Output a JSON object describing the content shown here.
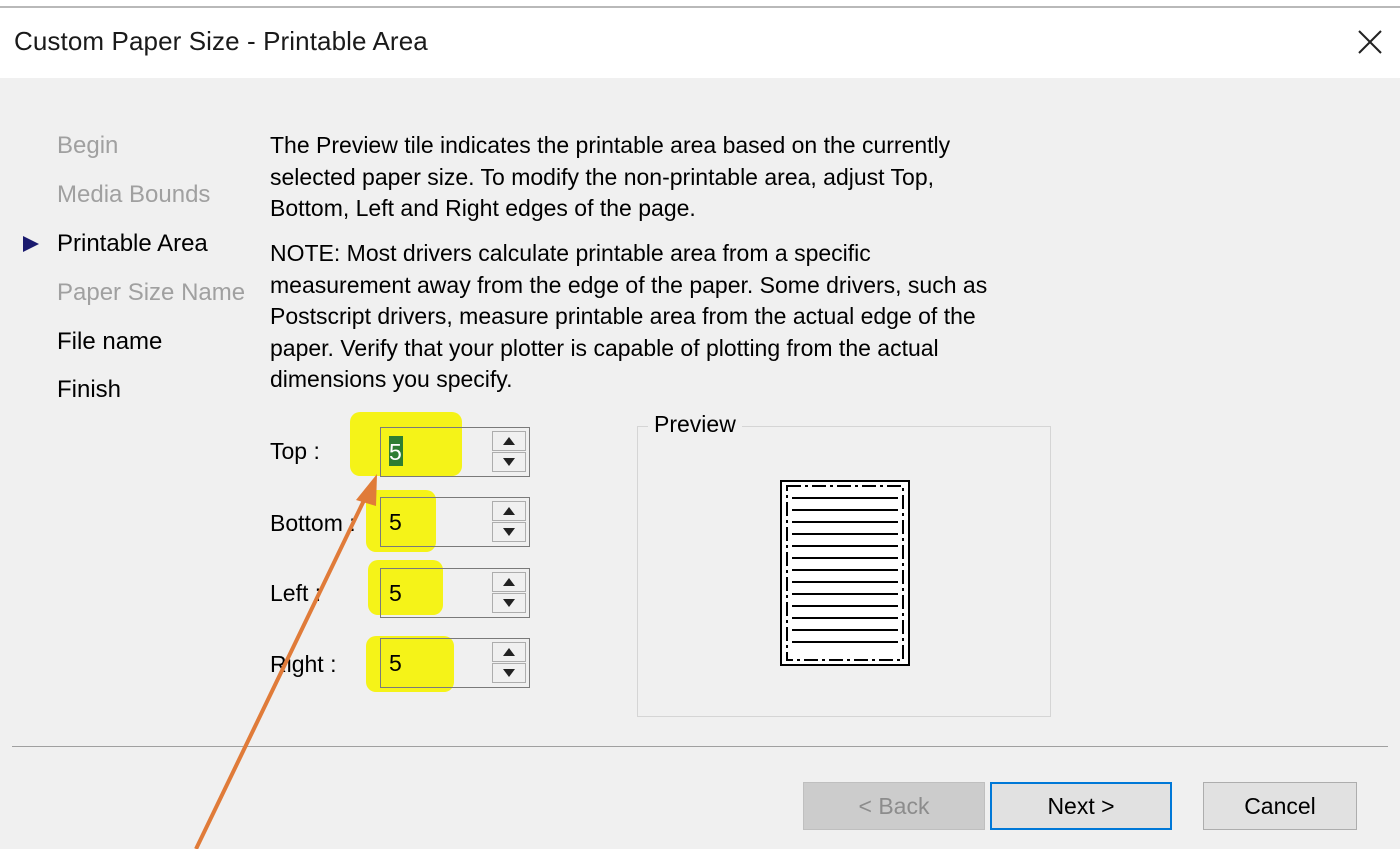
{
  "window": {
    "title": "Custom Paper Size - Printable Area",
    "close_icon": "close-icon"
  },
  "steps": [
    {
      "label": "Begin",
      "state": "disabled"
    },
    {
      "label": "Media Bounds",
      "state": "disabled"
    },
    {
      "label": "Printable Area",
      "state": "current"
    },
    {
      "label": "Paper Size Name",
      "state": "disabled"
    },
    {
      "label": "File name",
      "state": "enabled"
    },
    {
      "label": "Finish",
      "state": "enabled"
    }
  ],
  "description": {
    "para1_lines": [
      "The Preview tile indicates the printable area based on the currently",
      "selected paper size. To modify the non-printable area, adjust Top,",
      "Bottom, Left and Right edges of the page."
    ],
    "para2_lines": [
      "NOTE: Most drivers calculate printable area from a specific",
      "measurement away from the edge of the paper. Some drivers, such as",
      "Postscript drivers, measure printable area from the actual edge of the",
      "paper. Verify that your plotter is capable of plotting from the actual",
      "dimensions you specify."
    ]
  },
  "fields": {
    "top": {
      "label": "Top :",
      "value": "5"
    },
    "bottom": {
      "label": "Bottom :",
      "value": "5"
    },
    "left": {
      "label": "Left :",
      "value": "5"
    },
    "right": {
      "label": "Right :",
      "value": "5"
    }
  },
  "preview": {
    "label": "Preview"
  },
  "buttons": {
    "back": "< Back",
    "next": "Next >",
    "cancel": "Cancel"
  },
  "colors": {
    "highlight": "#f4f20c",
    "annotation_arrow": "#e07b39",
    "focus_border": "#0078d7",
    "step_arrow": "#1a1a6e"
  }
}
